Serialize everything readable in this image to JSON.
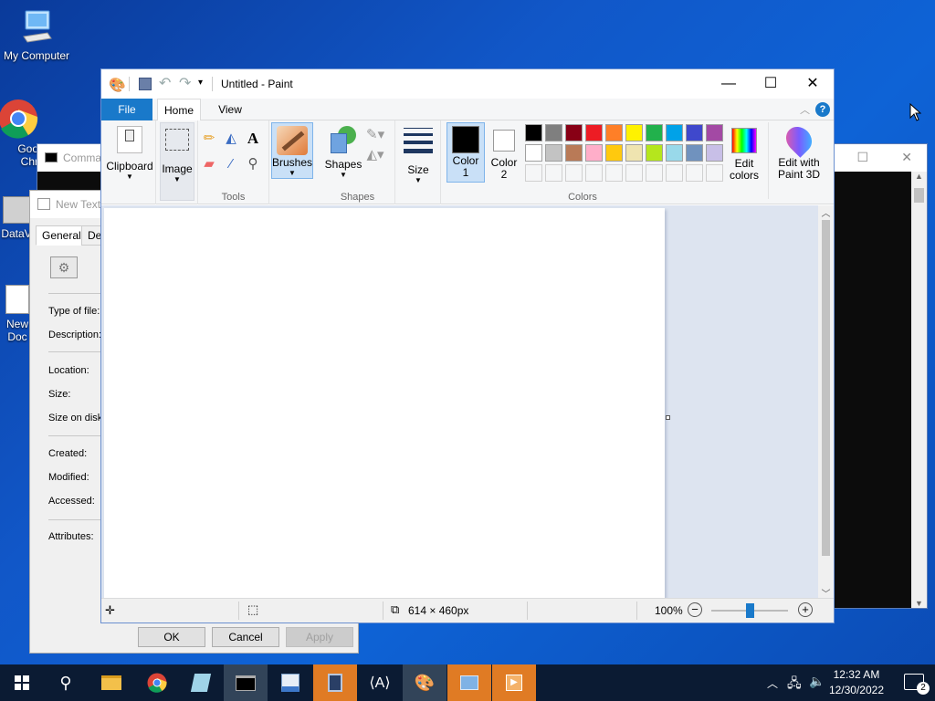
{
  "desktop": {
    "icons": [
      {
        "label": "My Computer"
      },
      {
        "label": "Goo Chr"
      },
      {
        "label": "DataV"
      },
      {
        "label": "New Doc"
      }
    ]
  },
  "cmd_window": {
    "title": "Comma"
  },
  "props_dialog": {
    "title": "New Text",
    "tabs": [
      "General",
      "De"
    ],
    "fields": [
      "Type of file:",
      "Description:",
      "Location:",
      "Size:",
      "Size on disk",
      "Created:",
      "Modified:",
      "Accessed:",
      "Attributes:"
    ],
    "buttons": {
      "ok": "OK",
      "cancel": "Cancel",
      "apply": "Apply"
    }
  },
  "paint": {
    "title": "Untitled - Paint",
    "tabs": {
      "file": "File",
      "home": "Home",
      "view": "View"
    },
    "ribbon": {
      "clipboard": "Clipboard",
      "image": "Image",
      "tools_group": "Tools",
      "brushes": "Brushes",
      "shapes": "Shapes",
      "shapes_group": "Shapes",
      "size": "Size",
      "color1": "Color\n1",
      "color2": "Color\n2",
      "colors_group": "Colors",
      "edit_colors": "Edit\ncolors",
      "edit_paint3d": "Edit with\nPaint 3D"
    },
    "palette_row1": [
      "#000000",
      "#7f7f7f",
      "#880015",
      "#ed1c24",
      "#ff7f27",
      "#fff200",
      "#22b14c",
      "#00a2e8",
      "#3f48cc",
      "#a349a4"
    ],
    "palette_row2": [
      "#ffffff",
      "#c3c3c3",
      "#b97a57",
      "#ffaec9",
      "#ffc90e",
      "#efe4b0",
      "#b5e61d",
      "#99d9ea",
      "#7092be",
      "#c8bfe7"
    ],
    "color1_value": "#000000",
    "color2_value": "#ffffff",
    "status": {
      "image_size": "614 × 460px",
      "zoom": "100%"
    }
  },
  "taskbar": {
    "time": "12:32 AM",
    "date": "12/30/2022",
    "notification_count": "2"
  }
}
